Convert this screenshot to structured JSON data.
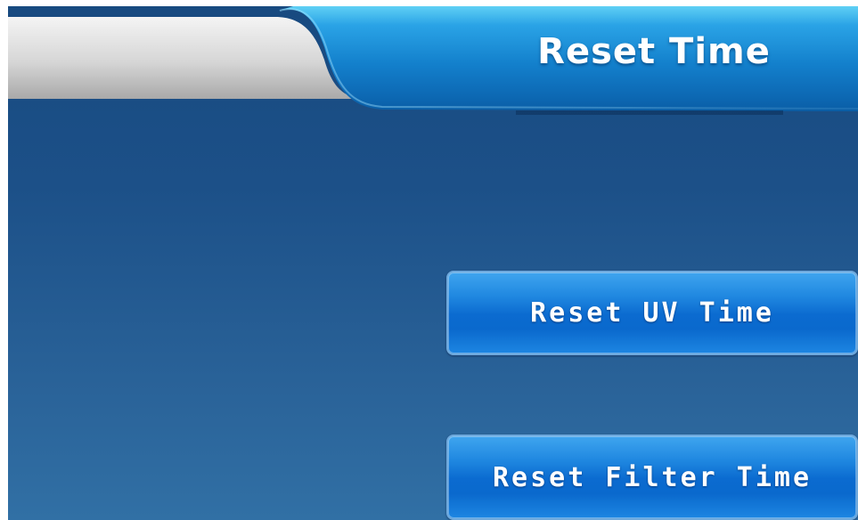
{
  "header": {
    "title": "Reset Time"
  },
  "actions": {
    "reset_uv_label": "Reset UV Time",
    "reset_filter_label": "Reset Filter Time"
  },
  "colors": {
    "panel_background": "#1c5088",
    "header_tab": "#1a8ad6",
    "button": "#0b6bd0",
    "left_tab": "#d8d8d8"
  }
}
